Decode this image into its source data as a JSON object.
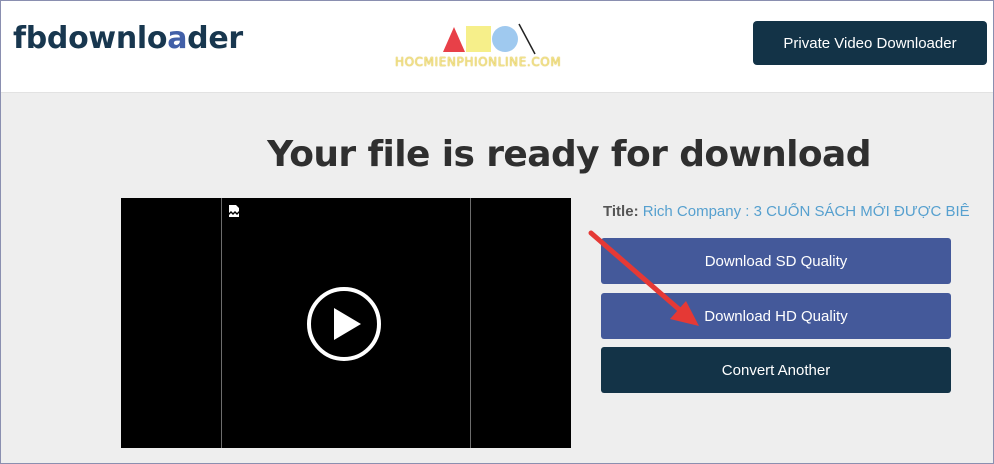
{
  "header": {
    "logo_main": "fbdownlo",
    "logo_accent": "a",
    "logo_end": "der",
    "watermark_text": "HOCMIENPHIONLINE.COM",
    "private_button_label": "Private Video Downloader"
  },
  "main": {
    "heading": "Your file is ready for download",
    "title_label": "Title:",
    "title_value": "Rich Company : 3 CUỐN SÁCH MỚI ĐƯỢC BIÊ",
    "buttons": {
      "sd": "Download SD Quality",
      "hd": "Download HD Quality",
      "convert": "Convert Another"
    }
  },
  "icons": {
    "play": "play-circle-icon",
    "broken_image": "broken-image-icon",
    "annotation": "red-arrow-annotation"
  },
  "colors": {
    "brand_dark": "#133347",
    "button_blue": "#44599a",
    "title_link": "#56a0cf",
    "arrow_red": "#e53935"
  }
}
